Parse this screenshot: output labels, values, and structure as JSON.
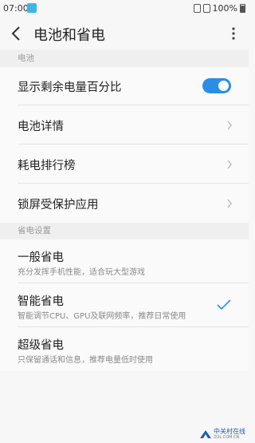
{
  "status_bar": {
    "time": "07:00",
    "battery": "100%"
  },
  "header": {
    "title": "电池和省电"
  },
  "sections": {
    "battery": {
      "label": "电池",
      "items": [
        {
          "label": "显示剩余电量百分比",
          "control": "toggle",
          "on": true
        },
        {
          "label": "电池详情",
          "control": "chevron"
        },
        {
          "label": "耗电排行榜",
          "control": "chevron"
        },
        {
          "label": "锁屏受保护应用",
          "control": "chevron"
        }
      ]
    },
    "power_saving": {
      "label": "省电设置",
      "modes": [
        {
          "label": "一般省电",
          "desc": "充分发挥手机性能，适合玩大型游戏",
          "selected": false
        },
        {
          "label": "智能省电",
          "desc": "智能调节CPU、GPU及联网频率，推荐日常使用",
          "selected": true
        },
        {
          "label": "超级省电",
          "desc": "只保留通话和信息，推荐电量低时使用",
          "selected": false
        }
      ]
    }
  },
  "colors": {
    "accent": "#2b8ee6",
    "background": "#f7f7f7",
    "section_header_bg": "#efefef"
  },
  "watermark": {
    "brand": "中关村在线",
    "site": "ZOL.COM.CN"
  },
  "icons": {
    "back": "back-arrow-icon",
    "more": "more-vertical-icon",
    "chevron": "chevron-right-icon",
    "check": "check-icon"
  }
}
